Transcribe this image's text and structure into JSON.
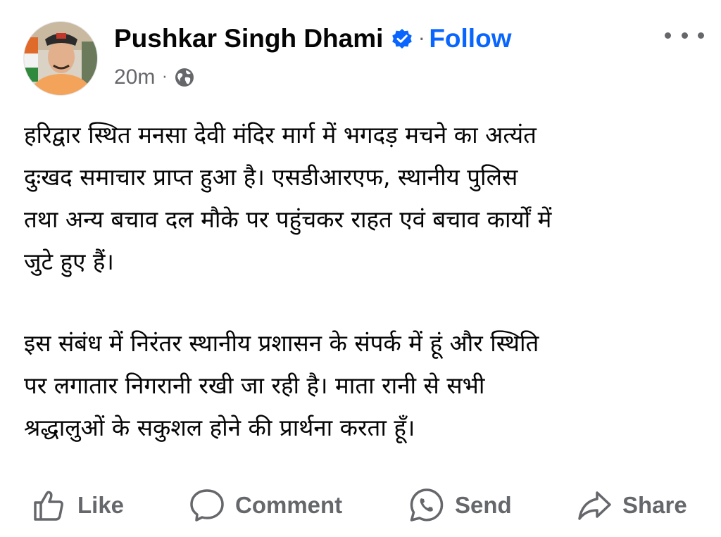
{
  "post": {
    "author": "Pushkar Singh Dhami",
    "verified_icon": "verified-badge-icon",
    "separator": "·",
    "follow_label": "Follow",
    "time": "20m",
    "audience_icon": "globe-icon",
    "more_icon": "more-options-icon",
    "paragraphs": [
      "हरिद्वार स्थित मनसा देवी मंदिर मार्ग में भगदड़ मचने का अत्यंत\nदुःखद समाचार प्राप्त हुआ है। एसडीआरएफ, स्थानीय पुलिस\nतथा अन्य बचाव दल मौके पर पहुंचकर राहत एवं बचाव कार्यों में\nजुटे हुए हैं।",
      "इस संबंध में निरंतर स्थानीय प्रशासन के संपर्क में हूं और स्थिति\nपर लगातार निगरानी रखी जा रही है। माता रानी से सभी\nश्रद्धालुओं के सकुशल होने की प्रार्थना करता हूँ।"
    ]
  },
  "actions": {
    "like": "Like",
    "comment": "Comment",
    "send": "Send",
    "share": "Share"
  },
  "colors": {
    "accent": "#0866ff",
    "secondary_text": "#65676b",
    "primary_text": "#050505"
  }
}
